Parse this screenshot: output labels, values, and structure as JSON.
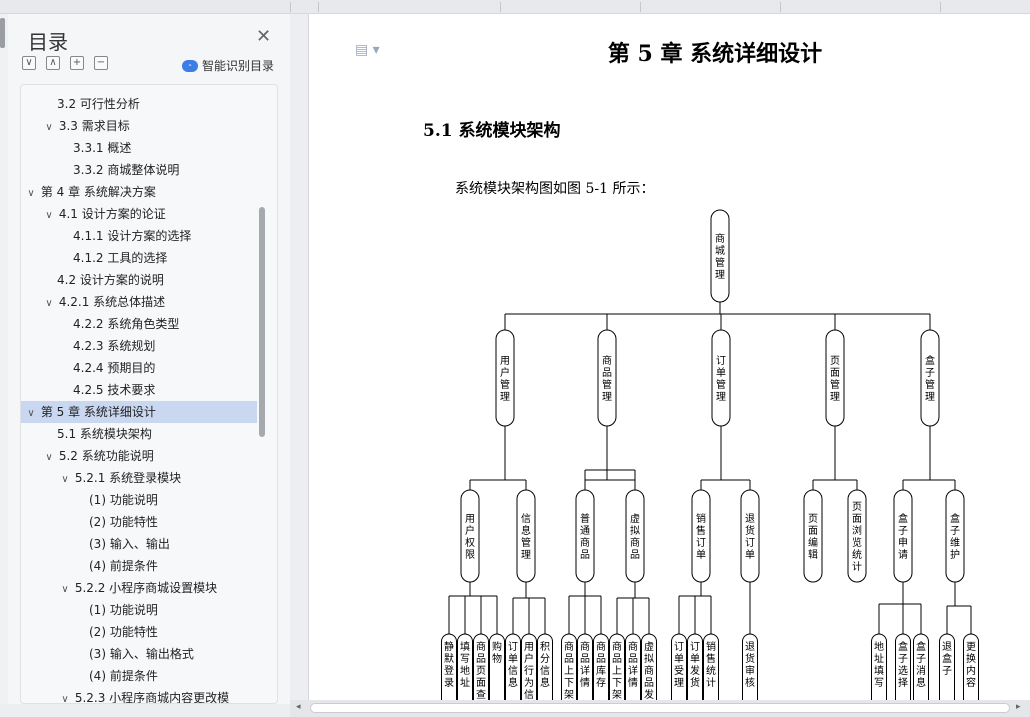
{
  "toc": {
    "title": "目录",
    "smart_label": "智能识别目录",
    "items": [
      {
        "label": "3.2  可行性分析",
        "level": 2,
        "caret": false
      },
      {
        "label": "3.3  需求目标",
        "level": 2,
        "caret": true
      },
      {
        "label": "3.3.1  概述",
        "level": 3,
        "caret": false
      },
      {
        "label": "3.3.2  商城整体说明",
        "level": 3,
        "caret": false
      },
      {
        "label": "第 4 章  系统解决方案",
        "level": 1,
        "caret": true
      },
      {
        "label": "4.1  设计方案的论证",
        "level": 2,
        "caret": true
      },
      {
        "label": "4.1.1  设计方案的选择",
        "level": 3,
        "caret": false
      },
      {
        "label": "4.1.2  工具的选择",
        "level": 3,
        "caret": false
      },
      {
        "label": "4.2  设计方案的说明",
        "level": 2,
        "caret": false
      },
      {
        "label": "4.2.1  系统总体描述",
        "level": 2,
        "caret": true
      },
      {
        "label": "4.2.2  系统角色类型",
        "level": 3,
        "caret": false
      },
      {
        "label": "4.2.3  系统规划",
        "level": 3,
        "caret": false
      },
      {
        "label": "4.2.4  预期目的",
        "level": 3,
        "caret": false
      },
      {
        "label": "4.2.5  技术要求",
        "level": 3,
        "caret": false
      },
      {
        "label": "第 5 章  系统详细设计",
        "level": 1,
        "caret": true,
        "active": true
      },
      {
        "label": "5.1  系统模块架构",
        "level": 2,
        "caret": false
      },
      {
        "label": "5.2  系统功能说明",
        "level": 2,
        "caret": true
      },
      {
        "label": "5.2.1  系统登录模块",
        "level": 3,
        "caret": true
      },
      {
        "label": "(1)  功能说明",
        "level": 4,
        "caret": false
      },
      {
        "label": "(2)  功能特性",
        "level": 4,
        "caret": false
      },
      {
        "label": "(3)  输入、输出",
        "level": 4,
        "caret": false
      },
      {
        "label": "(4)  前提条件",
        "level": 4,
        "caret": false
      },
      {
        "label": "5.2.2  小程序商城设置模块",
        "level": 3,
        "caret": true
      },
      {
        "label": "(1)  功能说明",
        "level": 4,
        "caret": false
      },
      {
        "label": "(2)  功能特性",
        "level": 4,
        "caret": false
      },
      {
        "label": "(3)  输入、输出格式",
        "level": 4,
        "caret": false
      },
      {
        "label": "(4)  前提条件",
        "level": 4,
        "caret": false
      },
      {
        "label": "5.2.3  小程序商城内容更改模",
        "level": 3,
        "caret": true
      }
    ]
  },
  "doc": {
    "chapter_title": "第 5 章  系统详细设计",
    "section_title": "5.1  系统模块架构",
    "body": "系统模块架构图如图 5-1 所示："
  },
  "tree": {
    "root": "商城管理",
    "modules": [
      "用户管理",
      "商品管理",
      "订单管理",
      "页面管理",
      "盒子管理"
    ],
    "subs": [
      "用户权限",
      "信息管理",
      "普通商品",
      "虚拟商品",
      "销售订单",
      "退货订单",
      "页面编辑",
      "页面浏览统计",
      "盒子申请",
      "盒子维护"
    ],
    "leaves": [
      "静默登录",
      "填写地址",
      "商品页面查看",
      "购物",
      "订单信息",
      "用户行为信息",
      "积分信息",
      "商品上下架",
      "商品详情",
      "商品库存",
      "商品上下架",
      "商品详情",
      "虚拟商品发布",
      "订单受理",
      "订单发货",
      "销售统计",
      "退货审核",
      "地址填写",
      "盒子选择",
      "盒子消息",
      "退盒子",
      "更换内容"
    ]
  }
}
